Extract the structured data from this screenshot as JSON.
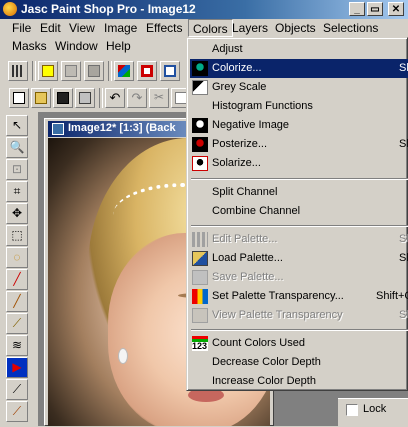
{
  "window": {
    "title": "Jasc Paint Shop Pro - Image12",
    "minimize_icon": "_",
    "restore_icon": "▭",
    "close_icon": "✕"
  },
  "menubar1": [
    "File",
    "Edit",
    "View",
    "Image",
    "Effects",
    "Colors",
    "Layers",
    "Objects",
    "Selections"
  ],
  "menubar2": [
    "Masks",
    "Window",
    "Help"
  ],
  "document": {
    "title": "Image12* [1:3] (Back"
  },
  "layer_panel": {
    "lock_label": "Lock"
  },
  "colors_menu": {
    "items": [
      {
        "label": "Adjust",
        "shortcut": "",
        "icon": "",
        "state": "normal"
      },
      {
        "label": "Colorize...",
        "shortcut": "Sh",
        "icon": "colorize-icon",
        "state": "highlighted"
      },
      {
        "label": "Grey Scale",
        "shortcut": "",
        "icon": "greyscale-icon",
        "state": "normal"
      },
      {
        "label": "Histogram Functions",
        "shortcut": "",
        "icon": "",
        "state": "normal"
      },
      {
        "label": "Negative Image",
        "shortcut": "",
        "icon": "negative-icon",
        "state": "normal"
      },
      {
        "label": "Posterize...",
        "shortcut": "Sh",
        "icon": "posterize-icon",
        "state": "normal"
      },
      {
        "label": "Solarize...",
        "shortcut": "",
        "icon": "solarize-icon",
        "state": "normal"
      },
      {
        "label": "Split Channel",
        "shortcut": "",
        "icon": "",
        "state": "normal"
      },
      {
        "label": "Combine Channel",
        "shortcut": "",
        "icon": "",
        "state": "normal"
      },
      {
        "label": "Edit Palette...",
        "shortcut": "Sh",
        "icon": "edit-palette-icon",
        "state": "disabled"
      },
      {
        "label": "Load Palette...",
        "shortcut": "Sh",
        "icon": "load-palette-icon",
        "state": "normal"
      },
      {
        "label": "Save Palette...",
        "shortcut": "",
        "icon": "save-palette-icon",
        "state": "disabled"
      },
      {
        "label": "Set Palette Transparency...",
        "shortcut": "Shift+C",
        "icon": "palette-transparency-icon",
        "state": "normal"
      },
      {
        "label": "View Palette Transparency",
        "shortcut": "Sh",
        "icon": "view-transparency-icon",
        "state": "disabled"
      },
      {
        "label": "Count Colors Used",
        "shortcut": "",
        "icon": "count-colors-icon",
        "state": "normal"
      },
      {
        "label": "Decrease Color Depth",
        "shortcut": "",
        "icon": "",
        "state": "normal"
      },
      {
        "label": "Increase Color Depth",
        "shortcut": "",
        "icon": "",
        "state": "normal"
      }
    ]
  },
  "colors": {
    "highlight": "#0a246a",
    "face": "#d4d0c8"
  }
}
